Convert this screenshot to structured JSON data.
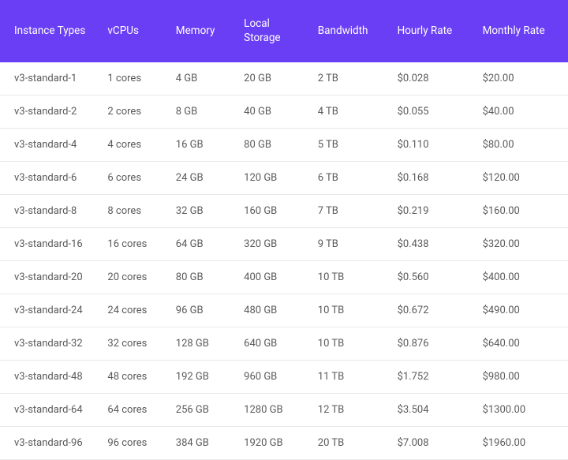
{
  "table": {
    "headers": {
      "instance": "Instance Types",
      "vcpus": "vCPUs",
      "memory": "Memory",
      "storage": "Local Storage",
      "bandwidth": "Bandwidth",
      "hourly": "Hourly Rate",
      "monthly": "Monthly Rate"
    },
    "rows": [
      {
        "instance": "v3-standard-1",
        "vcpus": "1 cores",
        "memory": "4 GB",
        "storage": "20 GB",
        "bandwidth": "2 TB",
        "hourly": "$0.028",
        "monthly": "$20.00"
      },
      {
        "instance": "v3-standard-2",
        "vcpus": "2 cores",
        "memory": "8 GB",
        "storage": "40 GB",
        "bandwidth": "4 TB",
        "hourly": "$0.055",
        "monthly": "$40.00"
      },
      {
        "instance": "v3-standard-4",
        "vcpus": "4 cores",
        "memory": "16 GB",
        "storage": "80 GB",
        "bandwidth": "5 TB",
        "hourly": "$0.110",
        "monthly": "$80.00"
      },
      {
        "instance": "v3-standard-6",
        "vcpus": "6 cores",
        "memory": "24 GB",
        "storage": "120 GB",
        "bandwidth": "6 TB",
        "hourly": "$0.168",
        "monthly": "$120.00"
      },
      {
        "instance": "v3-standard-8",
        "vcpus": "8 cores",
        "memory": "32 GB",
        "storage": "160 GB",
        "bandwidth": "7 TB",
        "hourly": "$0.219",
        "monthly": "$160.00"
      },
      {
        "instance": "v3-standard-16",
        "vcpus": "16 cores",
        "memory": "64 GB",
        "storage": "320 GB",
        "bandwidth": "9 TB",
        "hourly": "$0.438",
        "monthly": "$320.00"
      },
      {
        "instance": "v3-standard-20",
        "vcpus": "20 cores",
        "memory": "80 GB",
        "storage": "400 GB",
        "bandwidth": "10 TB",
        "hourly": "$0.560",
        "monthly": "$400.00"
      },
      {
        "instance": "v3-standard-24",
        "vcpus": "24 cores",
        "memory": "96 GB",
        "storage": "480 GB",
        "bandwidth": "10 TB",
        "hourly": "$0.672",
        "monthly": "$490.00"
      },
      {
        "instance": "v3-standard-32",
        "vcpus": "32 cores",
        "memory": "128 GB",
        "storage": "640 GB",
        "bandwidth": "10 TB",
        "hourly": "$0.876",
        "monthly": "$640.00"
      },
      {
        "instance": "v3-standard-48",
        "vcpus": "48 cores",
        "memory": "192 GB",
        "storage": "960 GB",
        "bandwidth": "11 TB",
        "hourly": "$1.752",
        "monthly": "$980.00"
      },
      {
        "instance": "v3-standard-64",
        "vcpus": "64 cores",
        "memory": "256 GB",
        "storage": "1280 GB",
        "bandwidth": "12 TB",
        "hourly": "$3.504",
        "monthly": "$1300.00"
      },
      {
        "instance": "v3-standard-96",
        "vcpus": "96 cores",
        "memory": "384 GB",
        "storage": "1920 GB",
        "bandwidth": "20 TB",
        "hourly": "$7.008",
        "monthly": "$1960.00"
      }
    ]
  }
}
